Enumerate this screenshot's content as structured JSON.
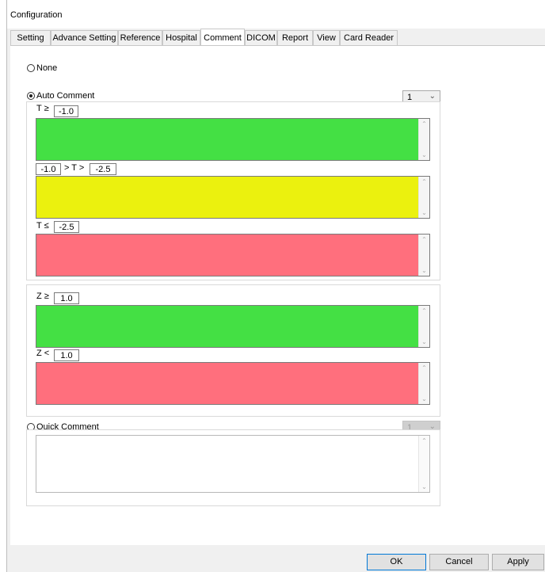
{
  "window": {
    "title": "Configuration"
  },
  "tabs": [
    {
      "label": "Setting"
    },
    {
      "label": "Advance Setting"
    },
    {
      "label": "Reference"
    },
    {
      "label": "Hospital"
    },
    {
      "label": "Comment",
      "active": true
    },
    {
      "label": "DICOM"
    },
    {
      "label": "Report"
    },
    {
      "label": "View"
    },
    {
      "label": "Card Reader"
    }
  ],
  "comment": {
    "none_label": "None",
    "auto_label": "Auto Comment",
    "auto_select": "1",
    "selected": "auto",
    "t_ge_label": "T ≥",
    "t_ge_value": "-1.0",
    "t_mid_low_value": "-1.0",
    "t_mid_label": "> T >",
    "t_mid_high_value": "-2.5",
    "t_le_label": "T ≤",
    "t_le_value": "-2.5",
    "z_ge_label": "Z ≥",
    "z_ge_value": "1.0",
    "z_lt_label": "Z <",
    "z_lt_value": "1.0",
    "quick_label": "Quick Comment",
    "quick_select": "1"
  },
  "colors": {
    "green": "#44e044",
    "yellow": "#ebf10e",
    "red": "#ff6f7d"
  },
  "buttons": {
    "ok": "OK",
    "cancel": "Cancel",
    "apply": "Apply"
  }
}
